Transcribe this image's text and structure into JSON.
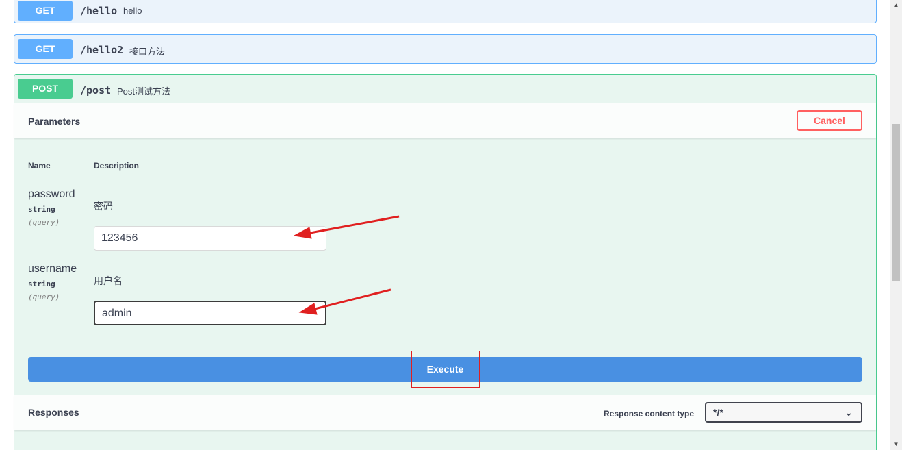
{
  "operations": [
    {
      "method": "GET",
      "path": "/hello",
      "summary": "hello"
    },
    {
      "method": "GET",
      "path": "/hello2",
      "summary": "接口方法"
    },
    {
      "method": "POST",
      "path": "/post",
      "summary": "Post测试方法"
    }
  ],
  "parameters_section": {
    "title": "Parameters",
    "cancel_label": "Cancel",
    "col_name": "Name",
    "col_description": "Description",
    "params": [
      {
        "name": "password",
        "type": "string",
        "in": "(query)",
        "description": "密码",
        "value": "123456"
      },
      {
        "name": "username",
        "type": "string",
        "in": "(query)",
        "description": "用户名",
        "value": "admin"
      }
    ],
    "execute_label": "Execute"
  },
  "responses_section": {
    "title": "Responses",
    "content_type_label": "Response content type",
    "content_type_value": "*/*"
  },
  "colors": {
    "get": "#61affe",
    "post": "#49cc90",
    "execute": "#4990e2",
    "cancel": "#ff6060",
    "annotation": "#e02020"
  }
}
